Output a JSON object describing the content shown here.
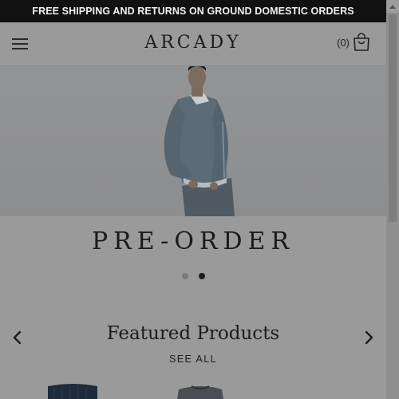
{
  "announcement": {
    "text": "FREE SHIPPING AND RETURNS ON GROUND DOMESTIC ORDERS"
  },
  "header": {
    "menu_icon": "hamburger-menu-icon",
    "logo": "ARCADY",
    "cart_count": "(0)",
    "cart_icon": "shopping-bag-icon"
  },
  "hero": {
    "title": "PRE-ORDER",
    "slides_total": 2,
    "active_slide": 2
  },
  "featured": {
    "title": "Featured Products",
    "see_all": "SEE ALL",
    "prev_icon": "chevron-left-icon",
    "next_icon": "chevron-right-icon"
  },
  "colors": {
    "overlay_bg": "#9a9a9a",
    "announcement_bg": "#111111",
    "text": "#1c1c1c"
  }
}
